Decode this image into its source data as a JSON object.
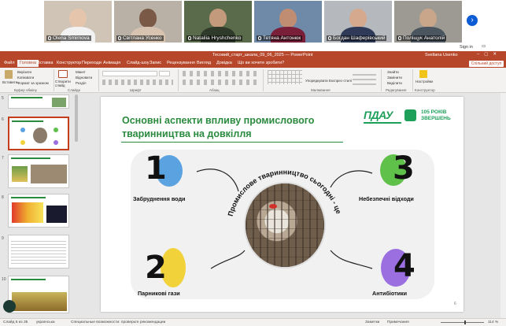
{
  "participants": [
    {
      "name": "Olena Smirnova"
    },
    {
      "name": "Світлана Усенко"
    },
    {
      "name": "Nataliia Hryshchenko"
    },
    {
      "name": "Тетяна Антонюк"
    },
    {
      "name": "Богдан Шаферівський"
    },
    {
      "name": "Поліщук Анатолій"
    }
  ],
  "next_icon": "chevron-right-icon",
  "sign_in": "Sign in",
  "window": {
    "title": "Тесовий_старт_шкала_09_06_2025 — PowerPoint",
    "user": "Svetlana Usenko",
    "controls": [
      "–",
      "▢",
      "✕"
    ]
  },
  "tabs": [
    "Файл",
    "Головна",
    "Вставка",
    "Конструктор",
    "Переходи",
    "Анімація",
    "Слайд-шоу",
    "Запис",
    "Рецензування",
    "Вигляд",
    "Довідка",
    "Що ви хочете зробити?"
  ],
  "active_tab": 1,
  "share_label": "Спільний доступ",
  "ribbon": {
    "paste": "Вставити",
    "cut": "Вирізати",
    "copy": "Копіювати",
    "format_painter": "Формат за зразком",
    "new_slide": "Створити слайд",
    "layout": "Макет",
    "reset": "Відновити",
    "section": "Розділ",
    "arrange": "Упорядкувати",
    "quick_styles": "Експрес-стилі",
    "find": "Знайти",
    "replace": "Замінити",
    "select": "Виділити",
    "designer": "Настройки",
    "groups": [
      "Буфер обміну",
      "Слайди",
      "Шрифт",
      "Абзац",
      "Малювання",
      "Редагування",
      "Конструктор"
    ]
  },
  "thumbnails": [
    {
      "num": "5"
    },
    {
      "num": "6"
    },
    {
      "num": "7"
    },
    {
      "num": "8"
    },
    {
      "num": "9"
    },
    {
      "num": "10"
    }
  ],
  "slide": {
    "title": "Основні аспекти впливу промислового тваринництва на довкілля",
    "logo_name": "ПДАУ",
    "logo_years": "105 РОКІВ ЗВЕРШЕНЬ",
    "center_caption": "Промислове тваринництво сьогодні - це:",
    "items": [
      {
        "num": "1",
        "label": "Забруднення води",
        "color": "#5aa2e0"
      },
      {
        "num": "2",
        "label": "Парникові гази",
        "color": "#f2d23a"
      },
      {
        "num": "3",
        "label": "Небезпечні відходи",
        "color": "#5fc04a"
      },
      {
        "num": "4",
        "label": "Антибіотики",
        "color": "#9b6fe0"
      }
    ],
    "page": "6"
  },
  "status": {
    "slide_of": "Слайд 6 из 35",
    "language": "українська",
    "accessibility": "Специальные возможности: проверьте рекомендации",
    "notes": "Заметки",
    "comments": "Примечания",
    "zoom": "114 %"
  }
}
